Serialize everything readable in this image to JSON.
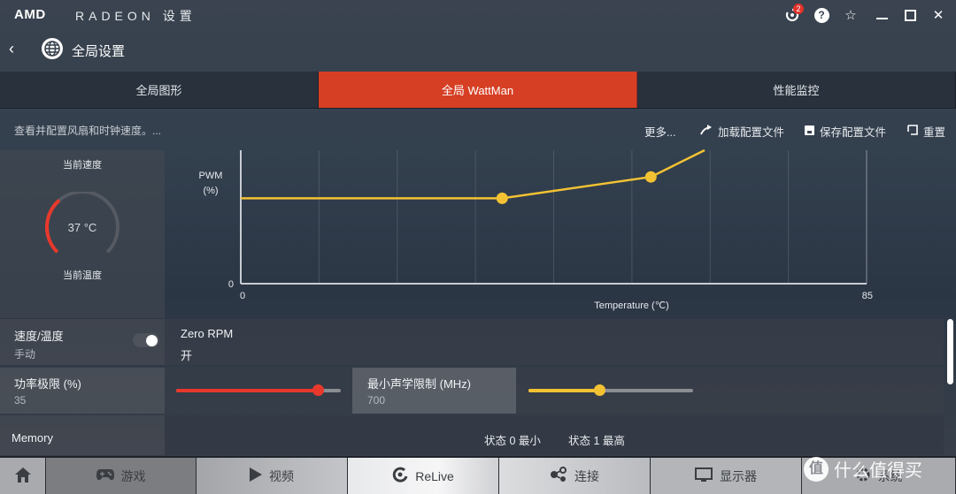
{
  "titlebar": {
    "brand": "AMD",
    "app_title": "RADEON 设置",
    "notification_count": "2",
    "icons": [
      "update-icon",
      "help-icon",
      "star-icon",
      "minimize-icon",
      "maximize-icon",
      "close-icon"
    ]
  },
  "header": {
    "back_icon": "‹",
    "title": "全局设置"
  },
  "tabs": [
    {
      "label": "全局图形",
      "active": false
    },
    {
      "label": "全局 WattMan",
      "active": true
    },
    {
      "label": "性能监控",
      "active": false
    }
  ],
  "toolbar": {
    "description": "查看并配置风扇和时钟速度。...",
    "more_label": "更多...",
    "load_profile_label": "加载配置文件",
    "save_profile_label": "保存配置文件",
    "reset_label": "重置"
  },
  "gauge": {
    "speed_label": "当前速度",
    "temp_label": "当前温度",
    "value": "37 °C",
    "fill_fraction": 0.35,
    "accent_color": "#e8382c"
  },
  "chart_data": {
    "type": "line",
    "title": "",
    "xlabel": "Temperature (℃)",
    "ylabel_line1": "PWM",
    "ylabel_line2": "(%)",
    "x_ticks": [
      "0",
      "85"
    ],
    "y_ticks": [
      "0"
    ],
    "xlim": [
      0,
      85
    ],
    "ylim": [
      0,
      100
    ],
    "grid": true,
    "series": [
      {
        "name": "fan-curve",
        "color": "#f2c233",
        "x": [
          0,
          35.5,
          55.7,
          63,
          85
        ],
        "y": [
          64,
          64,
          80,
          100,
          100
        ],
        "markers_x": [
          35.5,
          55.7
        ],
        "markers_y": [
          64,
          80
        ]
      }
    ]
  },
  "settings": {
    "speed_temp": {
      "label": "速度/温度",
      "value": "手动",
      "toggle_on": true
    },
    "zero_rpm": {
      "label": "Zero RPM",
      "value": "开"
    },
    "power_limit": {
      "label": "功率极限 (%)",
      "value": "35",
      "slider_fraction": 0.86,
      "color": "#e8382c"
    },
    "min_acoustic": {
      "label": "最小声学限制 (MHz)",
      "value": "700",
      "slider_fraction": 0.43,
      "color": "#f2c233"
    },
    "memory": {
      "label": "Memory",
      "state0": "状态 0 最小",
      "state1": "状态 1 最高"
    }
  },
  "bottom_nav": {
    "home_icon": "home-icon",
    "items": [
      {
        "label": "游戏",
        "icon": "gamepad-icon"
      },
      {
        "label": "视频",
        "icon": "play-icon"
      },
      {
        "label": "ReLive",
        "icon": "relive-icon"
      },
      {
        "label": "连接",
        "icon": "share-icon"
      },
      {
        "label": "显示器",
        "icon": "monitor-icon"
      },
      {
        "label": "系统",
        "icon": "system-icon"
      }
    ]
  },
  "watermark": {
    "badge": "值",
    "text": "什么值得买"
  },
  "colors": {
    "accent_red": "#d63f24",
    "curve_yellow": "#f2c233"
  }
}
